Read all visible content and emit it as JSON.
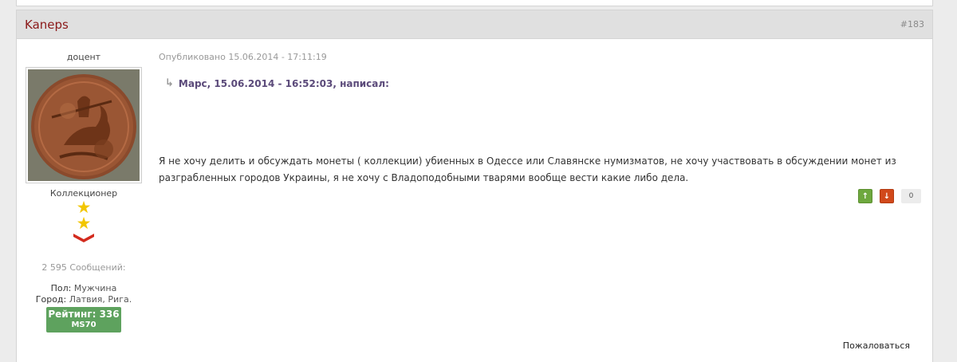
{
  "post": {
    "author": "Kaneps",
    "number": "#183",
    "date": "Опубликовано 15.06.2014 - 17:11:19",
    "quote_header": "Марс, 15.06.2014 - 16:52:03, написал:",
    "text": "Я не хочу делить и обсуждать монеты ( коллекции) убиенных в Одессе или Славянске нумизматов, не хочу участвовать в обсуждении монет из разграбленных городов Украины, я не хочу с Владоподобными тварями вообще вести какие либо дела.",
    "votes": {
      "up_icon": "arrow-up-icon",
      "down_icon": "arrow-down-icon",
      "count": "0"
    },
    "report_label": "Пожаловаться"
  },
  "profile": {
    "rank_title": "доцент",
    "avatar": "coin-image",
    "group": "Коллекционер",
    "star_count": 2,
    "post_count": "2 595 Сообщений:",
    "gender_label": "Пол:",
    "gender_value": "Мужчина",
    "city_label": "Город:",
    "city_value": "Латвия, Рига.",
    "rating": "Рейтинг: 336",
    "grade": "MS70"
  },
  "colors": {
    "author": "#8b1a1a",
    "header_bg": "#e0e0e0",
    "rating_bg": "#5ea25e",
    "vote_up": "#6ea83e",
    "vote_down": "#d1491b",
    "star": "#f2c600",
    "chevron": "#d32b1e"
  }
}
